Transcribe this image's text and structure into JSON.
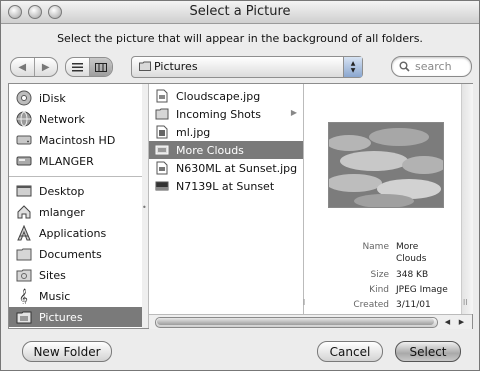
{
  "window": {
    "title": "Select a Picture"
  },
  "prompt": "Select the picture that will appear in the background of all folders.",
  "toolbar": {
    "back_icon": "back-arrow-icon",
    "forward_icon": "forward-arrow-icon",
    "location": "Pictures",
    "search_placeholder": "search"
  },
  "sidebar": {
    "items": [
      {
        "label": "iDisk",
        "icon": "idisk-icon"
      },
      {
        "label": "Network",
        "icon": "network-globe-icon"
      },
      {
        "label": "Macintosh HD",
        "icon": "hard-disk-icon"
      },
      {
        "label": "MLANGER",
        "icon": "disk-icon"
      },
      {
        "label": "Desktop",
        "icon": "desktop-icon"
      },
      {
        "label": "mlanger",
        "icon": "home-icon"
      },
      {
        "label": "Applications",
        "icon": "applications-icon"
      },
      {
        "label": "Documents",
        "icon": "documents-icon"
      },
      {
        "label": "Sites",
        "icon": "sites-icon"
      },
      {
        "label": "Music",
        "icon": "music-icon"
      },
      {
        "label": "Pictures",
        "icon": "pictures-icon",
        "selected": true
      }
    ]
  },
  "files": [
    {
      "name": "Cloudscape.jpg",
      "icon": "image-file-icon"
    },
    {
      "name": "Incoming Shots",
      "icon": "folder-icon",
      "has_children": true
    },
    {
      "name": "ml.jpg",
      "icon": "image-file-icon"
    },
    {
      "name": "More Clouds",
      "icon": "image-file-icon",
      "selected": true
    },
    {
      "name": "N630ML at Sunset.jpg",
      "icon": "image-file-icon"
    },
    {
      "name": "N7139L at Sunset",
      "icon": "image-file-icon"
    }
  ],
  "preview": {
    "name_label": "Name",
    "name_value_line1": "More",
    "name_value_line2": "Clouds",
    "size_label": "Size",
    "size_value": "348 KB",
    "kind_label": "Kind",
    "kind_value": "JPEG Image",
    "created_label": "Created",
    "created_value": "3/11/01"
  },
  "buttons": {
    "new_folder": "New Folder",
    "cancel": "Cancel",
    "select": "Select"
  }
}
